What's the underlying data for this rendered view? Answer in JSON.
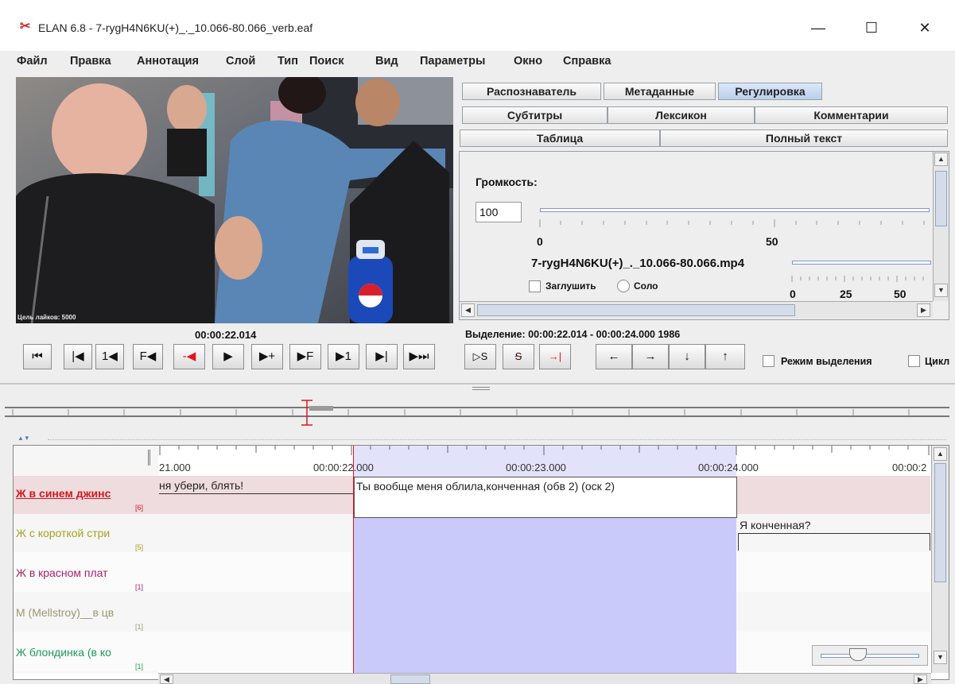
{
  "window": {
    "title": "ELAN 6.8 - 7-rygH4N6KU(+)_._10.066-80.066_verb.eaf",
    "minimize": "—",
    "maximize": "☐",
    "close": "✕"
  },
  "menu": [
    "Файл",
    "Правка",
    "Аннотация",
    "Слой",
    "Тип",
    "Поиск",
    "Вид",
    "Параметры",
    "Окно",
    "Справка"
  ],
  "video": {
    "watermark_text": "Цель лайков: 5000"
  },
  "tabs": {
    "row1": [
      "Распознаватель",
      "Метаданные",
      "Регулировка"
    ],
    "row2": [
      "Субтитры",
      "Лексикон",
      "Комментарии"
    ],
    "row3": [
      "Таблица",
      "Полный текст"
    ],
    "selected": "Регулировка"
  },
  "volume": {
    "label": "Громкость:",
    "value": "100",
    "scale_min": "0",
    "scale_mid": "50",
    "file_name": "7-rygH4N6KU(+)_._10.066-80.066.mp4",
    "mute_label": "Заглушить",
    "solo_label": "Соло",
    "mini_scale": [
      "0",
      "25",
      "50"
    ]
  },
  "player": {
    "current_time": "00:00:22.014",
    "selection_text": "Выделение: 00:00:22.014 - 00:00:24.000  1986",
    "selection_mode_label": "Режим выделения",
    "loop_label": "Цикл",
    "buttons": [
      "⏮",
      "|◀",
      "1◀",
      "F◀",
      "-◀",
      "▶",
      "▶+",
      "▶F",
      "▶1",
      "▶|",
      "▶⏭"
    ],
    "sel_buttons": [
      "▷S",
      "S",
      "→|"
    ],
    "arrow_buttons": [
      "←",
      "→",
      "↓",
      "↑"
    ]
  },
  "timeline": {
    "ticks": [
      "21.000",
      "00:00:22.000",
      "00:00:23.000",
      "00:00:24.000",
      "00:00:2"
    ]
  },
  "tiers": [
    {
      "name": "Ж в синем джинс",
      "count": "[6]",
      "color": "#d0191e"
    },
    {
      "name": "Ж с короткой стри",
      "count": "[5]",
      "color": "#a6a11e"
    },
    {
      "name": "Ж в красном плат",
      "count": "[1]",
      "color": "#a8226a"
    },
    {
      "name": "М (Mellstroy)__в цв",
      "count": "[1]",
      "color": "#9b9870"
    },
    {
      "name": "Ж блондинка (в ко",
      "count": "[1]",
      "color": "#1d9a5d"
    }
  ],
  "annotations": {
    "a1": "ня убери, блять!",
    "a2": "Ты вообще меня облила,конченная (обв 2) (оск 2)",
    "a3": "Я конченная?"
  },
  "colors": {
    "selection": "#c9c9fa",
    "crosshair": "#e0161b",
    "tier1_bg": "#efdcdf"
  }
}
